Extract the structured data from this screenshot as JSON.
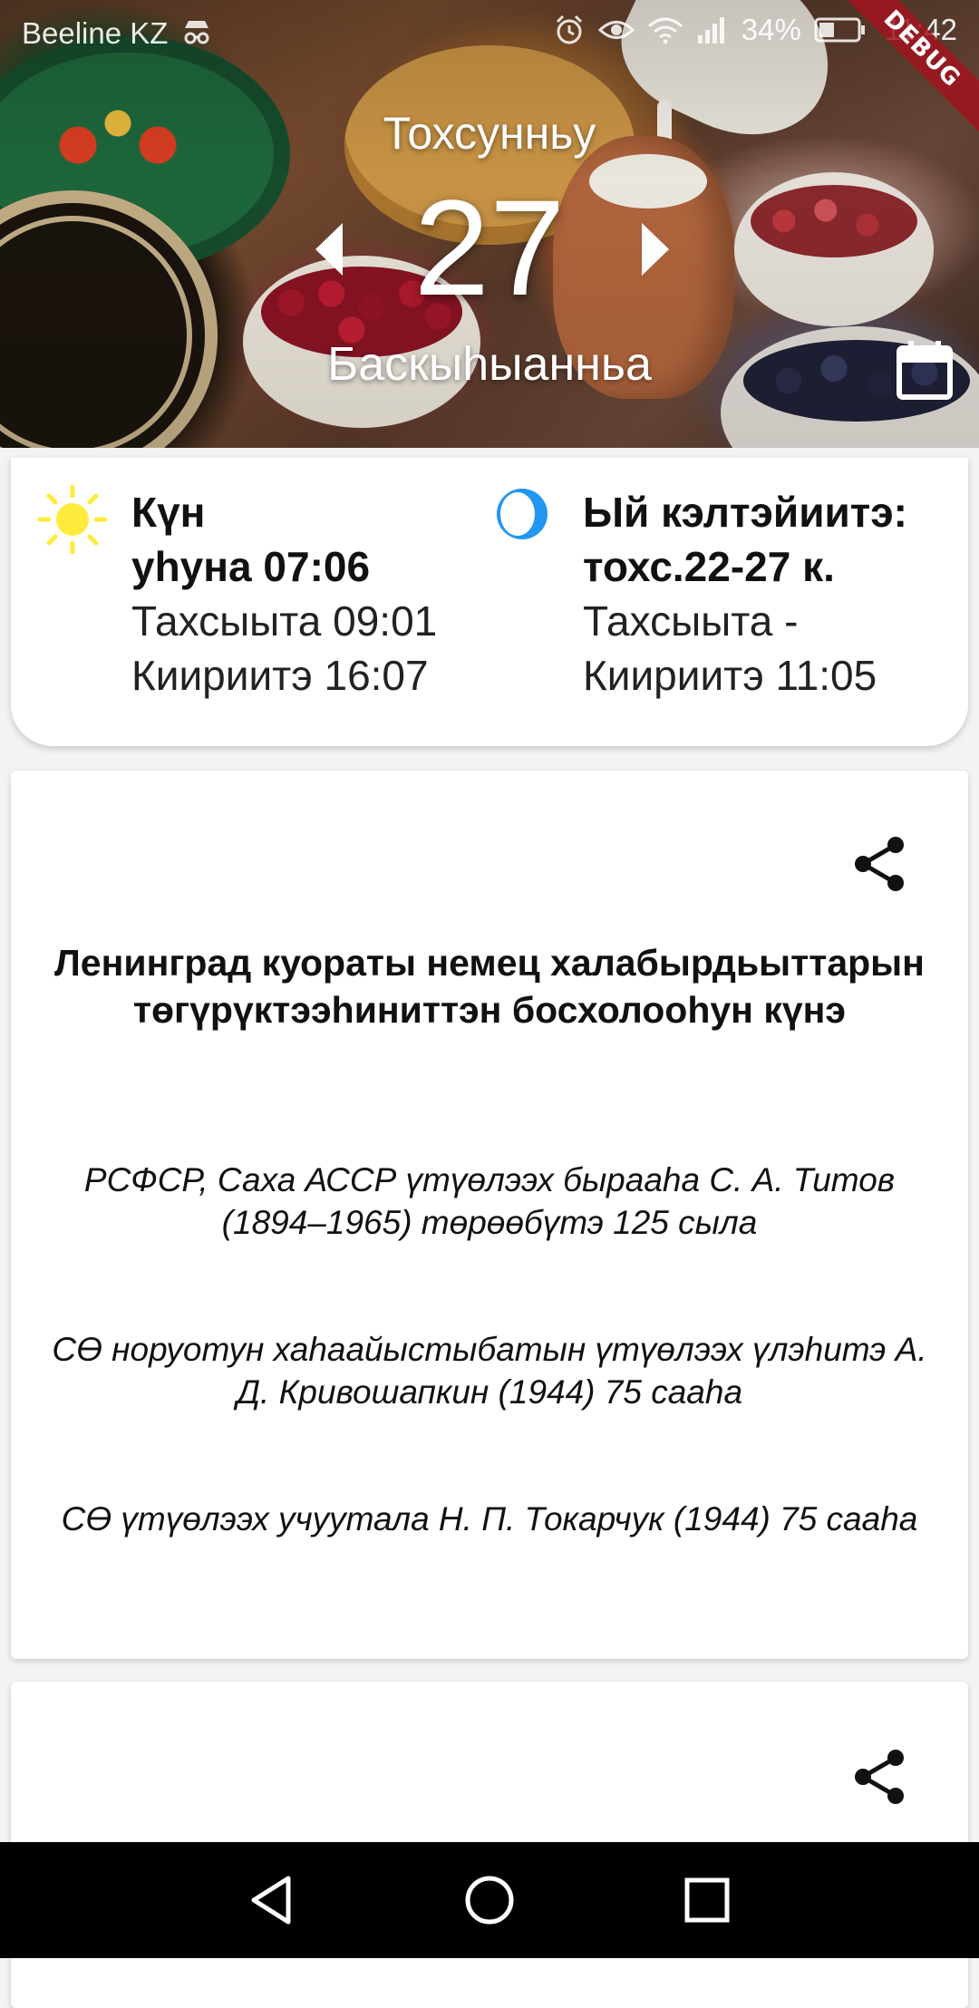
{
  "status_bar": {
    "carrier": "Beeline KZ",
    "battery_percent": "34%",
    "time": "11:42",
    "debug_label": "DEBUG",
    "icons": [
      "incognito-icon",
      "alarm-icon",
      "eye-icon",
      "wifi-icon",
      "signal-icon",
      "battery-icon"
    ]
  },
  "header": {
    "month": "Тохсунньу",
    "day": "27",
    "weekday": "Баскыһыанньа",
    "icons": [
      "chevron-left-icon",
      "chevron-right-icon",
      "calendar-icon"
    ]
  },
  "sun": {
    "title_line1": "Күн",
    "title_line2": "уһуна 07:06",
    "rise": "Тахсыыта 09:01",
    "set": "Киириитэ 16:07",
    "icon": "sun-icon",
    "color": "#FFEB3B"
  },
  "moon": {
    "title_line1": "Ый кэлтэйиитэ:",
    "title_line2": "тохс.22-27 к.",
    "rise": "Тахсыыта -",
    "set": "Киириитэ 11:05",
    "icon": "moon-icon",
    "color": "#2196F3"
  },
  "events": {
    "title": "Ленинград куораты немец халабырдьыттарын төгүрүктээһиниттэн босхолооһун күнэ",
    "items": [
      "РСФСР, Саха АССР үтүөлээх бырааһа С. А. Титов (1894–1965) төрөөбүтэ 125 сыла",
      "СӨ норуотун хаһаайыстыбатын үтүөлээх үлэһитэ А. Д. Кривошапкин (1944) 75 сааһа",
      "СӨ үтүөлээх учуутала Н. П. Токарчук (1944) 75 сааһа"
    ],
    "share_icon": "share-icon"
  },
  "nav_bar": {
    "icons": [
      "back-icon",
      "home-icon",
      "recents-icon"
    ]
  }
}
